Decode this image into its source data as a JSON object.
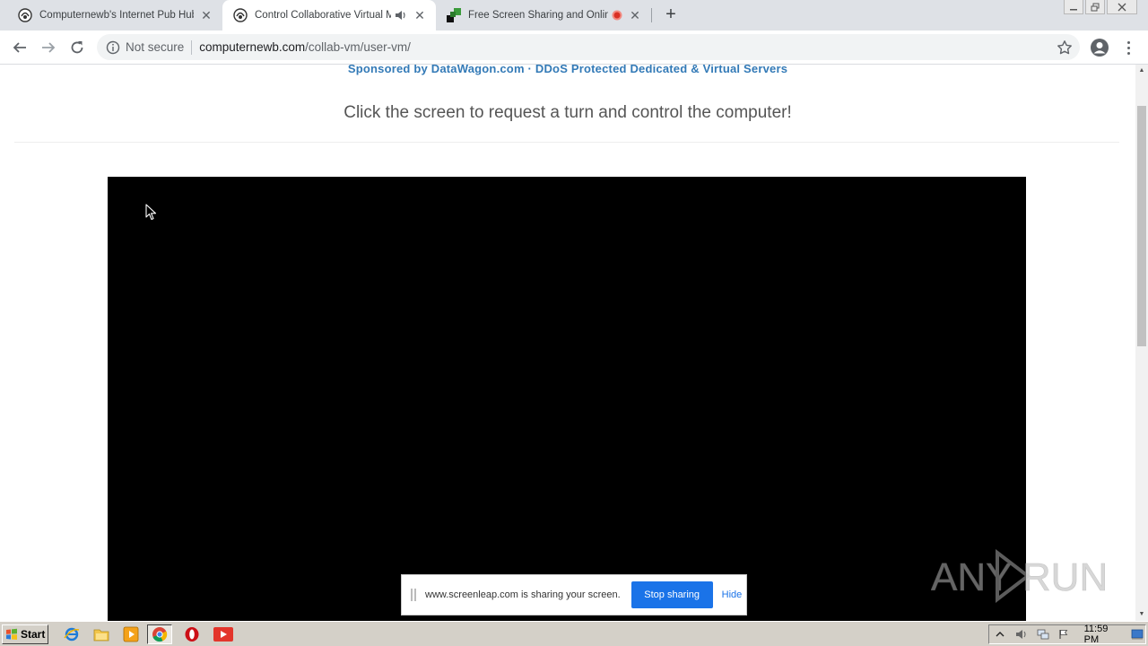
{
  "tabs": [
    {
      "title": "Computernewb's Internet Pub Hub",
      "active": false
    },
    {
      "title": "Control Collaborative Virtual Ma",
      "active": true
    },
    {
      "title": "Free Screen Sharing and Online",
      "active": false
    }
  ],
  "address": {
    "security_label": "Not secure",
    "host": "computernewb.com",
    "path": "/collab-vm/user-vm/"
  },
  "page": {
    "sponsor_prefix": "Sponsored by ",
    "sponsor_link": "DataWagon.com",
    "sponsor_separator": " · ",
    "sponsor_tagline": "DDoS Protected Dedicated & Virtual Servers",
    "instructions": "Click the screen to request a turn and control the computer!"
  },
  "sharebar": {
    "message": "www.screenleap.com is sharing your screen.",
    "stop_label": "Stop sharing",
    "hide_label": "Hide"
  },
  "watermark": "ANY RUN",
  "taskbar": {
    "start_label": "Start",
    "clock": "11:59 PM"
  },
  "colors": {
    "link": "#337ab7",
    "accent": "#1a73e8",
    "tabstrip": "#dee1e6"
  }
}
